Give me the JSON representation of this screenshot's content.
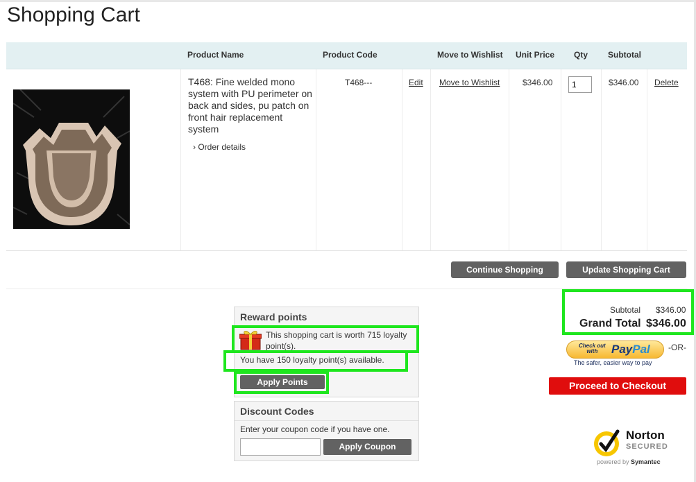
{
  "page": {
    "title": "Shopping Cart"
  },
  "table": {
    "headers": {
      "product_name": "Product Name",
      "product_code": "Product Code",
      "move_to_wishlist": "Move to Wishlist",
      "unit_price": "Unit Price",
      "qty": "Qty",
      "subtotal": "Subtotal"
    },
    "items": [
      {
        "name": "T468: Fine welded mono system with PU perimeter on back and sides, pu patch on front hair replacement system",
        "order_details_label": "Order details",
        "code": "T468---",
        "edit_label": "Edit",
        "wishlist_label": "Move to Wishlist",
        "unit_price": "$346.00",
        "qty": "1",
        "subtotal": "$346.00",
        "delete_label": "Delete"
      }
    ]
  },
  "actions": {
    "continue_shopping": "Continue Shopping",
    "update_cart": "Update Shopping Cart"
  },
  "reward": {
    "title": "Reward points",
    "worth_text": "This shopping cart is worth 715 loyalty point(s).",
    "available_text": "You have 150 loyalty point(s) available.",
    "apply_label": "Apply Points"
  },
  "discount": {
    "title": "Discount Codes",
    "prompt": "Enter your coupon code if you have one.",
    "input_value": "",
    "apply_label": "Apply Coupon"
  },
  "summary": {
    "subtotal_label": "Subtotal",
    "subtotal_value": "$346.00",
    "grand_total_label": "Grand Total",
    "grand_total_value": "$346.00"
  },
  "paypal": {
    "small_text_line1": "Check out",
    "small_text_line2": "with",
    "logo_pay": "Pay",
    "logo_pal": "Pal",
    "or_text": "-OR-",
    "tagline": "The safer, easier way to pay"
  },
  "checkout": {
    "label": "Proceed to Checkout"
  },
  "norton": {
    "brand": "Norton",
    "secured": "SECURED",
    "powered_by": "powered by",
    "symantec": "Symantec"
  },
  "colors": {
    "header_bg": "#e3f0f2",
    "button_gray": "#626262",
    "checkout_red": "#e00d0d",
    "highlight_green": "#1ee61e",
    "paypal_gold": "#f7b832"
  }
}
